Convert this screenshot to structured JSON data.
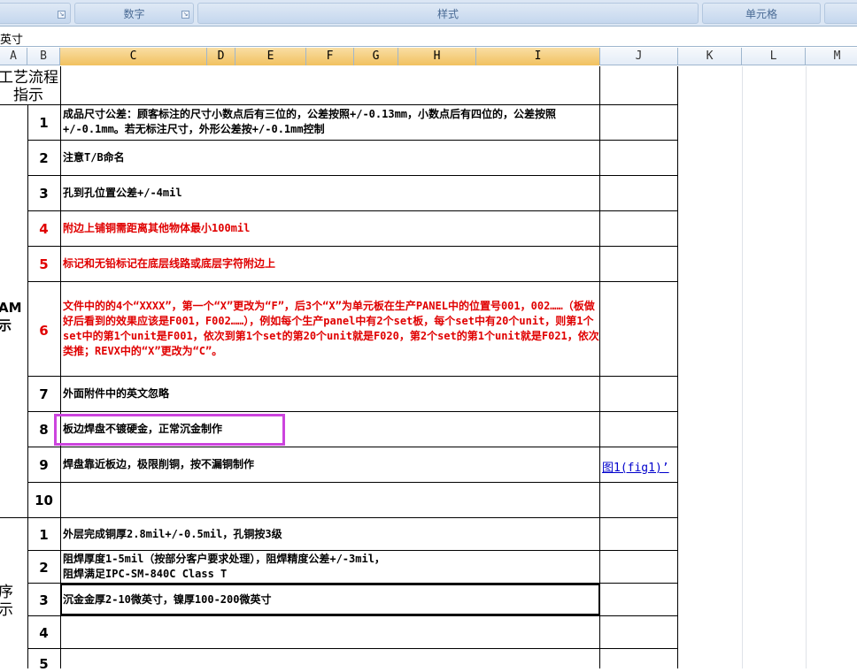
{
  "ribbon": {
    "groups": [
      {
        "label": ""
      },
      {
        "label": "数字"
      },
      {
        "label": "样式"
      },
      {
        "label": "单元格"
      },
      {
        "label": ""
      }
    ]
  },
  "formula_bar": {
    "value": "英寸"
  },
  "columns": [
    "A",
    "B",
    "C",
    "D",
    "E",
    "F",
    "G",
    "H",
    "I",
    "J",
    "K",
    "L",
    "M"
  ],
  "sections": {
    "header_label": "工艺流程\n指示",
    "cam_label": "AM\n示",
    "process_label": "序\n示"
  },
  "cam_rows": [
    {
      "num": "1",
      "text": "成品尺寸公差：顾客标注的尺寸小数点后有三位的，公差按照+/-0.13mm，小数点后有四位的，公差按照+/-0.1mm。若无标注尺寸，外形公差按+/-0.1mm控制",
      "color": "#000000"
    },
    {
      "num": "2",
      "text": "注意T/B命名",
      "color": "#000000"
    },
    {
      "num": "3",
      "text": "孔到孔位置公差+/-4mil",
      "color": "#000000"
    },
    {
      "num": "4",
      "text": "附边上铺铜需距离其他物体最小100mil",
      "color": "#e00000"
    },
    {
      "num": "5",
      "text": "标记和无铅标记在底层线路或底层字符附边上",
      "color": "#e00000"
    },
    {
      "num": "6",
      "text": "文件中的的4个“XXXX”，第一个“X”更改为“F”，后3个“X”为单元板在生产PANEL中的位置号001，002……（板做好后看到的效果应该是F001，F002……），例如每个生产panel中有2个set板，每个set中有20个unit，则第1个set中的第1个unit是F001，依次到第1个set的第20个unit就是F020，第2个set的第1个unit就是F021，依次类推；REVX中的“X”更改为“C”。",
      "color": "#e00000"
    },
    {
      "num": "7",
      "text": "外面附件中的英文忽略",
      "color": "#000000"
    },
    {
      "num": "8",
      "text": "板边焊盘不镀硬金，正常沉金制作",
      "color": "#000000"
    },
    {
      "num": "9",
      "text": "焊盘靠近板边，极限削铜，按不漏铜制作",
      "color": "#000000",
      "link": "图1(fig1)’"
    },
    {
      "num": "10",
      "text": "",
      "color": "#000000"
    }
  ],
  "process_rows": [
    {
      "num": "1",
      "text": "外层完成铜厚2.8mil+/-0.5mil，孔铜按3级"
    },
    {
      "num": "2",
      "text": "阻焊厚度1-5mil（按部分客户要求处理），阻焊精度公差+/-3mil，\n阻焊满足IPC-SM-840C Class T"
    },
    {
      "num": "3",
      "text": "沉金金厚2-10微英寸，镍厚100-200微英寸"
    },
    {
      "num": "4",
      "text": ""
    },
    {
      "num": "5",
      "text": ""
    }
  ],
  "colors": {
    "highlight_box": "#cc44dd",
    "red_text": "#e00000",
    "link": "#0000cc",
    "header_selected": "#f1c15f"
  }
}
